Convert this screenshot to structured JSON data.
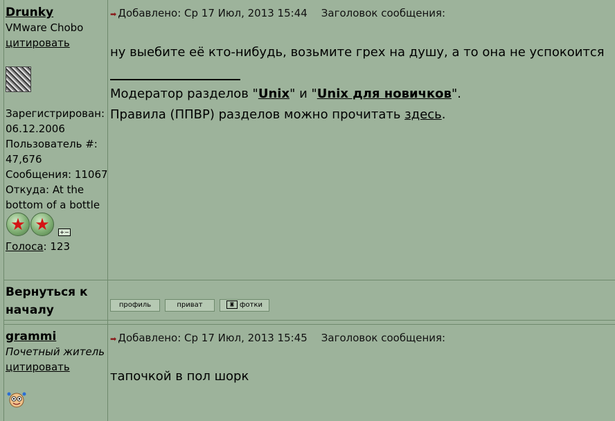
{
  "posts": [
    {
      "author": "Drunky",
      "rank": "VMware Chobo",
      "quote_link": "цитировать",
      "registered_label": "Зарегистрирован:",
      "registered_date": "06.12.2006",
      "user_label": "Пользователь #:",
      "user_id": "47,676",
      "messages": "Сообщения: 11067",
      "from_line1": "Откуда: At the",
      "from_line2": "bottom of a bottle",
      "votes_link": "Голоса",
      "votes_value": ": 123",
      "added": "Добавлено: Ср 17 Июл, 2013 15:44",
      "subject_label": "Заголовок сообщения:",
      "text": "ну выебите её кто-нибудь, возьмите грех на душу, а то она не успокоится",
      "sig_prefix": "Модератор разделов \"",
      "sig_unix": "Unix",
      "sig_mid": "\" и \"",
      "sig_unix_new": "Unix для новичков",
      "sig_suffix": "\".",
      "rules_prefix": "Правила (ППВР) разделов можно прочитать ",
      "rules_link": "здесь",
      "rules_suffix": "."
    },
    {
      "author": "grammi",
      "rank": "Почетный житель",
      "quote_link": "цитировать",
      "added": "Добавлено: Ср 17 Июл, 2013 15:45",
      "subject_label": "Заголовок сообщения:",
      "text": "тапочкой в пол шорк"
    }
  ],
  "back_to_top": {
    "line1": "Вернуться к",
    "line2": "началу"
  },
  "buttons": {
    "profile": "профиль",
    "private": "приват",
    "photos": "фотки"
  },
  "icons": [
    "post-arrow-icon",
    "medal-star-icon",
    "expand-icon",
    "camera-icon",
    "avatar-image"
  ]
}
